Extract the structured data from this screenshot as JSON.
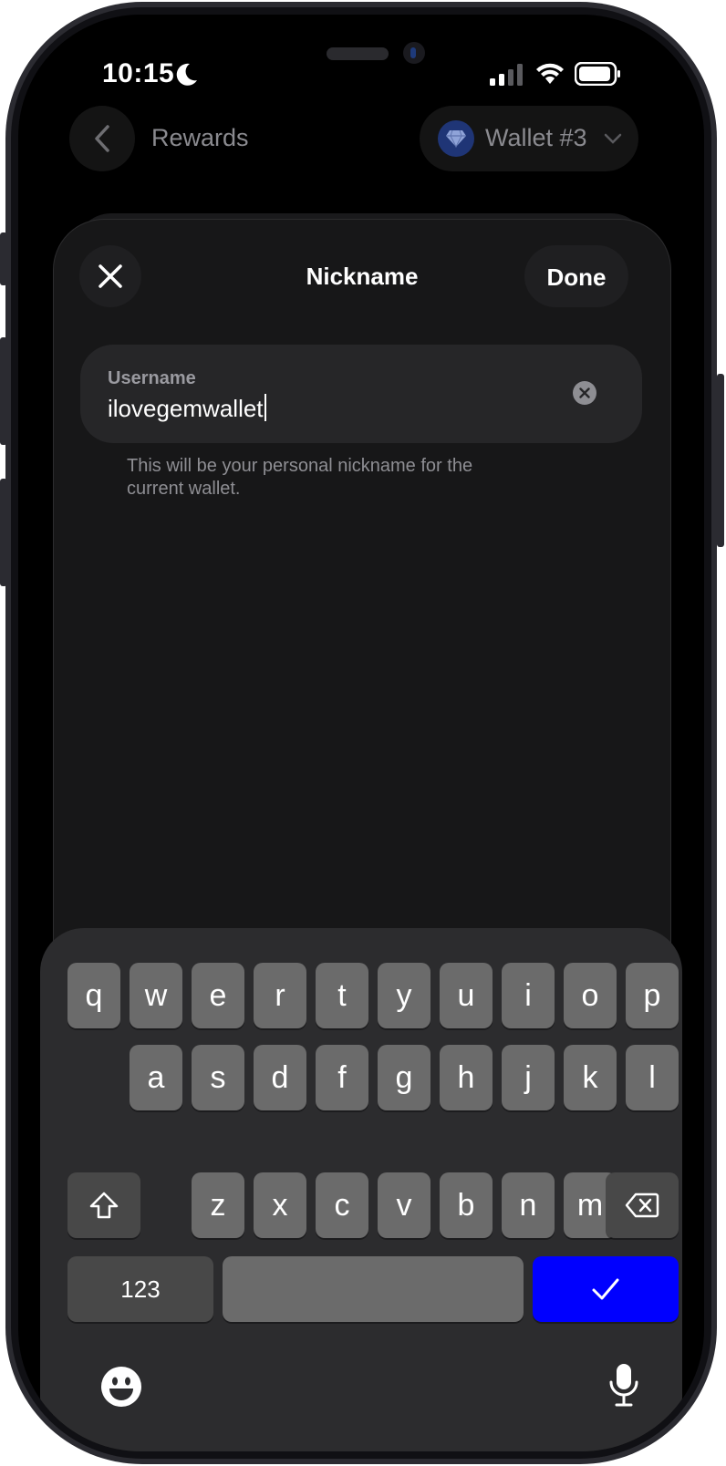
{
  "status_bar": {
    "time": "10:15",
    "icons": [
      "moon-icon",
      "cellular-signal-icon",
      "wifi-icon",
      "battery-icon"
    ]
  },
  "header": {
    "back_label": "Rewards",
    "wallet_label": "Wallet #3",
    "wallet_icon": "diamond-gem-icon",
    "chevron_icon": "chevron-down-icon"
  },
  "sheet": {
    "title": "Nickname",
    "done_label": "Done",
    "close_icon": "close-icon"
  },
  "username_field": {
    "label": "Username",
    "value": "ilovegemwallet",
    "clear_icon": "clear-icon"
  },
  "helper_text": "This will be your personal nickname for the current wallet.",
  "keyboard": {
    "row1": [
      "q",
      "w",
      "e",
      "r",
      "t",
      "y",
      "u",
      "i",
      "o",
      "p"
    ],
    "row2": [
      "a",
      "s",
      "d",
      "f",
      "g",
      "h",
      "j",
      "k",
      "l"
    ],
    "row3": [
      "z",
      "x",
      "c",
      "v",
      "b",
      "n",
      "m"
    ],
    "numbers_label": "123",
    "shift_icon": "shift-icon",
    "delete_icon": "delete-backspace-icon",
    "return_icon": "checkmark-icon",
    "emoji_icon": "emoji-icon",
    "dictation_icon": "microphone-icon"
  },
  "colors": {
    "accent": "#0000ff",
    "background": "#000000",
    "sheet": "#171718",
    "key": "#6b6b6b"
  }
}
